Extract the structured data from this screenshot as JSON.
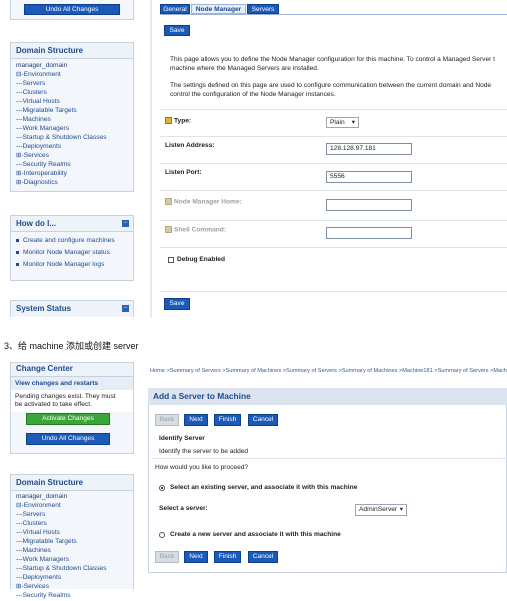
{
  "top": {
    "undo_btn": "Undo All Changes",
    "domain_structure": {
      "title": "Domain Structure",
      "tree": [
        "manager_domain",
        "⊟-Environment",
        "---Servers",
        "---Clusters",
        "---Virtual Hosts",
        "---Migratable Targets",
        "---Machines",
        "---Work Managers",
        "---Startup & Shutdown Classes",
        "---Deployments",
        "⊞-Services",
        "---Security Realms",
        "⊞-Interoperability",
        "⊞-Diagnostics"
      ]
    },
    "how_do_i": {
      "title": "How do I...",
      "items": [
        "Create and configure machines",
        "Monitor Node Manager status",
        "Monitor Node Manager logs"
      ]
    },
    "system_status": {
      "title": "System Status"
    },
    "tabs": [
      "General",
      "Node Manager",
      "Servers"
    ],
    "save_label": "Save",
    "desc1": [
      "This page allows you to define the Node Manager configuration for this machine. To control a Managed Server t",
      "machine where the Managed Servers are installed."
    ],
    "desc2": [
      "The settings defined on this page are used to configure communication between the current domain and Node",
      "control the configuration of the Node Manager instances."
    ],
    "type_label": "Type:",
    "type_value": "Plain",
    "listen_address_label": "Listen Address:",
    "listen_address_value": "128.128.97.181",
    "listen_port_label": "Listen Port:",
    "listen_port_value": "5556",
    "nm_home_label": "Node Manager Home:",
    "shell_cmd_label": "Shell Command:",
    "debug_label": "Debug Enabled"
  },
  "caption": "3、给 machine 添加或创建 server",
  "bottom": {
    "change_center": {
      "title": "Change Center",
      "link": "View changes and restarts",
      "pending": [
        "Pending changes exist. They must",
        "be activated to take effect."
      ],
      "activate": "Activate Changes",
      "undo": "Undo All Changes"
    },
    "breadcrumb": "Home >Summary of Servers >Summary of Machines >Summary of Servers >Summary of Machines >Machine181 >Summary of Servers >Mach",
    "domain_structure": {
      "title": "Domain Structure",
      "tree": [
        "manager_domain",
        "⊟-Environment",
        "---Servers",
        "---Clusters",
        "---Virtual Hosts",
        "---Migratable Targets",
        "---Machines",
        "---Work Managers",
        "---Startup & Shutdown Classes",
        "---Deployments",
        "⊞-Services",
        "---Security Realms"
      ]
    },
    "wizard_title": "Add a Server to Machine",
    "btn_back": "Back",
    "btn_next": "Next",
    "btn_finish": "Finish",
    "btn_cancel": "Cancel",
    "section_title": "Identify Server",
    "section_desc": "Identify the server to be added",
    "question": "How would you like to proceed?",
    "opt1": "Select an existing server, and associate it with this machine",
    "select_label": "Select a server:",
    "select_value": "AdminServer",
    "opt2": "Create a new server and associate it with this machine"
  }
}
